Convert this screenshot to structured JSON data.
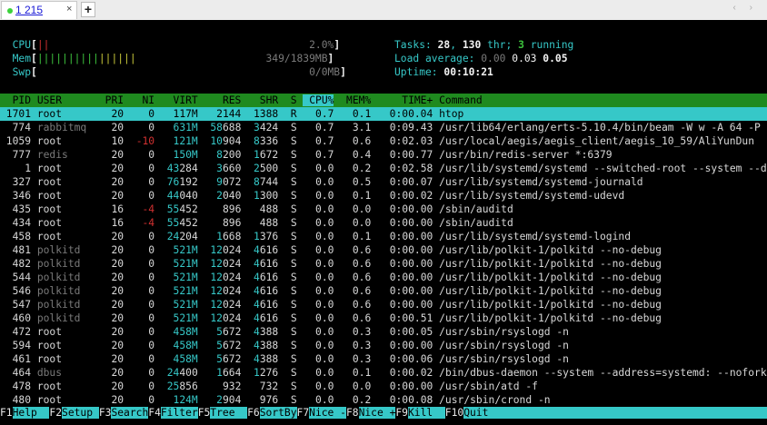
{
  "tab": {
    "label": "1 215",
    "close": "×",
    "add": "+",
    "nav": "‹ ›"
  },
  "meters": {
    "cpu": {
      "label": "CPU",
      "bar": "||",
      "value": "2.0%"
    },
    "mem": {
      "label": "Mem",
      "bar_green": "||||||||||",
      "bar_yellow": "||||||",
      "value": "349/1839MB"
    },
    "swp": {
      "label": "Swp",
      "value": "0/0MB"
    }
  },
  "summary": {
    "tasks_label": "Tasks:",
    "tasks": "28",
    "threads": "130",
    "thr_label": "thr;",
    "running": "3",
    "running_label": "running",
    "load_label": "Load average:",
    "load1": "0.00",
    "load5": "0.03",
    "load15": "0.05",
    "uptime_label": "Uptime:",
    "uptime": "00:10:21"
  },
  "columns": [
    "PID",
    "USER",
    "PRI",
    "NI",
    "VIRT",
    "RES",
    "SHR",
    "S",
    "CPU%",
    "MEM%",
    "TIME+",
    "Command"
  ],
  "processes": [
    {
      "pid": "1701",
      "user": "root",
      "pri": "20",
      "ni": "0",
      "virt": "117M",
      "res": "2144",
      "shr": "1388",
      "s": "R",
      "cpu": "0.7",
      "mem": "0.1",
      "time": "0:00.04",
      "cmd": "htop"
    },
    {
      "pid": "774",
      "user": "rabbitmq",
      "pri": "20",
      "ni": "0",
      "virt": "631M",
      "res": "58688",
      "shr": "3424",
      "s": "S",
      "cpu": "0.7",
      "mem": "3.1",
      "time": "0:09.43",
      "cmd": "/usr/lib64/erlang/erts-5.10.4/bin/beam -W w -A 64 -P 104"
    },
    {
      "pid": "1059",
      "user": "root",
      "pri": "10",
      "ni": "-10",
      "virt": "121M",
      "res": "10904",
      "shr": "8336",
      "s": "S",
      "cpu": "0.7",
      "mem": "0.6",
      "time": "0:02.03",
      "cmd": "/usr/local/aegis/aegis_client/aegis_10_59/AliYunDun"
    },
    {
      "pid": "777",
      "user": "redis",
      "pri": "20",
      "ni": "0",
      "virt": "150M",
      "res": "8200",
      "shr": "1672",
      "s": "S",
      "cpu": "0.7",
      "mem": "0.4",
      "time": "0:00.77",
      "cmd": "/usr/bin/redis-server *:6379"
    },
    {
      "pid": "1",
      "user": "root",
      "pri": "20",
      "ni": "0",
      "virt": "43284",
      "res": "3660",
      "shr": "2500",
      "s": "S",
      "cpu": "0.0",
      "mem": "0.2",
      "time": "0:02.58",
      "cmd": "/usr/lib/systemd/systemd --switched-root --system --dese"
    },
    {
      "pid": "327",
      "user": "root",
      "pri": "20",
      "ni": "0",
      "virt": "76192",
      "res": "9072",
      "shr": "8744",
      "s": "S",
      "cpu": "0.0",
      "mem": "0.5",
      "time": "0:00.07",
      "cmd": "/usr/lib/systemd/systemd-journald"
    },
    {
      "pid": "346",
      "user": "root",
      "pri": "20",
      "ni": "0",
      "virt": "44040",
      "res": "2040",
      "shr": "1300",
      "s": "S",
      "cpu": "0.0",
      "mem": "0.1",
      "time": "0:00.02",
      "cmd": "/usr/lib/systemd/systemd-udevd"
    },
    {
      "pid": "435",
      "user": "root",
      "pri": "16",
      "ni": "-4",
      "virt": "55452",
      "res": "896",
      "shr": "488",
      "s": "S",
      "cpu": "0.0",
      "mem": "0.0",
      "time": "0:00.00",
      "cmd": "/sbin/auditd"
    },
    {
      "pid": "434",
      "user": "root",
      "pri": "16",
      "ni": "-4",
      "virt": "55452",
      "res": "896",
      "shr": "488",
      "s": "S",
      "cpu": "0.0",
      "mem": "0.0",
      "time": "0:00.00",
      "cmd": "/sbin/auditd"
    },
    {
      "pid": "458",
      "user": "root",
      "pri": "20",
      "ni": "0",
      "virt": "24204",
      "res": "1668",
      "shr": "1376",
      "s": "S",
      "cpu": "0.0",
      "mem": "0.1",
      "time": "0:00.00",
      "cmd": "/usr/lib/systemd/systemd-logind"
    },
    {
      "pid": "481",
      "user": "polkitd",
      "pri": "20",
      "ni": "0",
      "virt": "521M",
      "res": "12024",
      "shr": "4616",
      "s": "S",
      "cpu": "0.0",
      "mem": "0.6",
      "time": "0:00.00",
      "cmd": "/usr/lib/polkit-1/polkitd --no-debug"
    },
    {
      "pid": "482",
      "user": "polkitd",
      "pri": "20",
      "ni": "0",
      "virt": "521M",
      "res": "12024",
      "shr": "4616",
      "s": "S",
      "cpu": "0.0",
      "mem": "0.6",
      "time": "0:00.00",
      "cmd": "/usr/lib/polkit-1/polkitd --no-debug"
    },
    {
      "pid": "544",
      "user": "polkitd",
      "pri": "20",
      "ni": "0",
      "virt": "521M",
      "res": "12024",
      "shr": "4616",
      "s": "S",
      "cpu": "0.0",
      "mem": "0.6",
      "time": "0:00.00",
      "cmd": "/usr/lib/polkit-1/polkitd --no-debug"
    },
    {
      "pid": "546",
      "user": "polkitd",
      "pri": "20",
      "ni": "0",
      "virt": "521M",
      "res": "12024",
      "shr": "4616",
      "s": "S",
      "cpu": "0.0",
      "mem": "0.6",
      "time": "0:00.00",
      "cmd": "/usr/lib/polkit-1/polkitd --no-debug"
    },
    {
      "pid": "547",
      "user": "polkitd",
      "pri": "20",
      "ni": "0",
      "virt": "521M",
      "res": "12024",
      "shr": "4616",
      "s": "S",
      "cpu": "0.0",
      "mem": "0.6",
      "time": "0:00.00",
      "cmd": "/usr/lib/polkit-1/polkitd --no-debug"
    },
    {
      "pid": "460",
      "user": "polkitd",
      "pri": "20",
      "ni": "0",
      "virt": "521M",
      "res": "12024",
      "shr": "4616",
      "s": "S",
      "cpu": "0.0",
      "mem": "0.6",
      "time": "0:00.51",
      "cmd": "/usr/lib/polkit-1/polkitd --no-debug"
    },
    {
      "pid": "472",
      "user": "root",
      "pri": "20",
      "ni": "0",
      "virt": "458M",
      "res": "5672",
      "shr": "4388",
      "s": "S",
      "cpu": "0.0",
      "mem": "0.3",
      "time": "0:00.05",
      "cmd": "/usr/sbin/rsyslogd -n"
    },
    {
      "pid": "594",
      "user": "root",
      "pri": "20",
      "ni": "0",
      "virt": "458M",
      "res": "5672",
      "shr": "4388",
      "s": "S",
      "cpu": "0.0",
      "mem": "0.3",
      "time": "0:00.00",
      "cmd": "/usr/sbin/rsyslogd -n"
    },
    {
      "pid": "461",
      "user": "root",
      "pri": "20",
      "ni": "0",
      "virt": "458M",
      "res": "5672",
      "shr": "4388",
      "s": "S",
      "cpu": "0.0",
      "mem": "0.3",
      "time": "0:00.06",
      "cmd": "/usr/sbin/rsyslogd -n"
    },
    {
      "pid": "464",
      "user": "dbus",
      "pri": "20",
      "ni": "0",
      "virt": "24400",
      "res": "1664",
      "shr": "1276",
      "s": "S",
      "cpu": "0.0",
      "mem": "0.1",
      "time": "0:00.02",
      "cmd": "/bin/dbus-daemon --system --address=systemd: --nofork --"
    },
    {
      "pid": "478",
      "user": "root",
      "pri": "20",
      "ni": "0",
      "virt": "25856",
      "res": "932",
      "shr": "732",
      "s": "S",
      "cpu": "0.0",
      "mem": "0.0",
      "time": "0:00.00",
      "cmd": "/usr/sbin/atd -f"
    },
    {
      "pid": "480",
      "user": "root",
      "pri": "20",
      "ni": "0",
      "virt": "124M",
      "res": "2904",
      "shr": "976",
      "s": "S",
      "cpu": "0.0",
      "mem": "0.2",
      "time": "0:00.08",
      "cmd": "/usr/sbin/crond -n"
    }
  ],
  "fkeys": [
    {
      "key": "F1",
      "label": "Help"
    },
    {
      "key": "F2",
      "label": "Setup"
    },
    {
      "key": "F3",
      "label": "Search"
    },
    {
      "key": "F4",
      "label": "Filter"
    },
    {
      "key": "F5",
      "label": "Tree"
    },
    {
      "key": "F6",
      "label": "SortBy"
    },
    {
      "key": "F7",
      "label": "Nice -"
    },
    {
      "key": "F8",
      "label": "Nice +"
    },
    {
      "key": "F9",
      "label": "Kill"
    },
    {
      "key": "F10",
      "label": "Quit"
    }
  ]
}
